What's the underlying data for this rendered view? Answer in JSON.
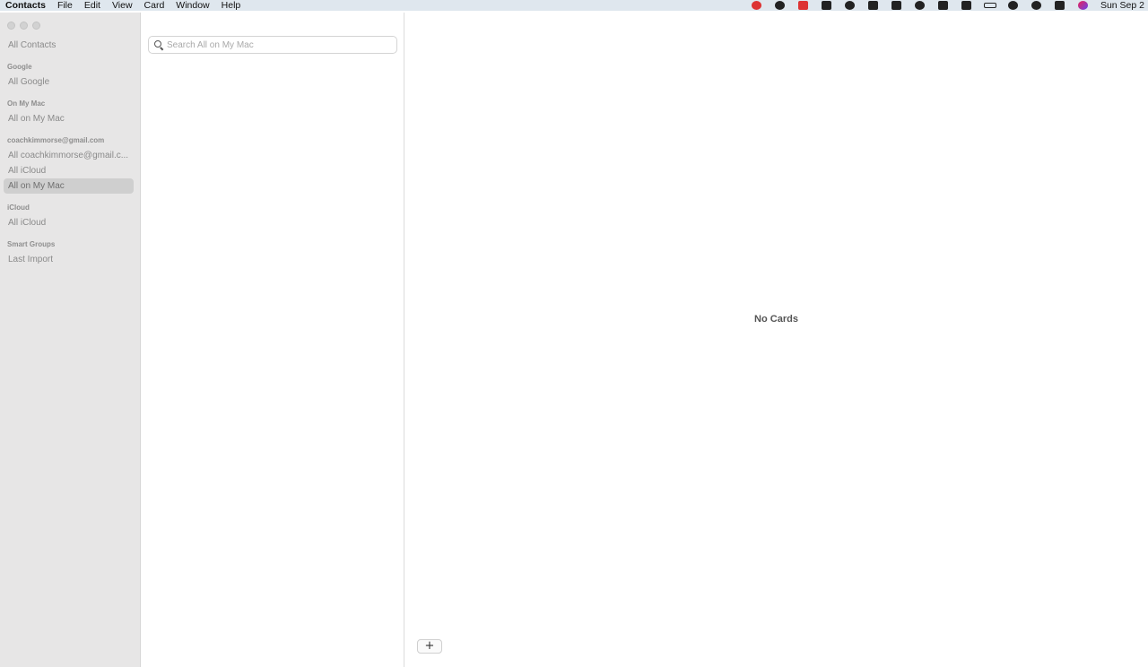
{
  "menubar": {
    "app_name": "Contacts",
    "menus": [
      "File",
      "Edit",
      "View",
      "Card",
      "Window",
      "Help"
    ],
    "clock": "Sun Sep 2"
  },
  "sidebar": {
    "all_contacts": "All Contacts",
    "groups": [
      {
        "header": "Google",
        "items": [
          "All Google"
        ]
      },
      {
        "header": "On My Mac",
        "items": [
          "All on My Mac"
        ]
      },
      {
        "header": "coachkimmorse@gmail.com",
        "items": [
          "All coachkimmorse@gmail.c...",
          "All iCloud",
          "All on My Mac"
        ]
      },
      {
        "header": "iCloud",
        "items": [
          "All iCloud"
        ]
      },
      {
        "header": "Smart Groups",
        "items": [
          "Last Import"
        ]
      }
    ],
    "selected": "All on My Mac (coachkimmorse@gmail.com)"
  },
  "search": {
    "placeholder": "Search All on My Mac",
    "value": ""
  },
  "detail": {
    "empty_message": "No Cards",
    "add_label": "+"
  }
}
